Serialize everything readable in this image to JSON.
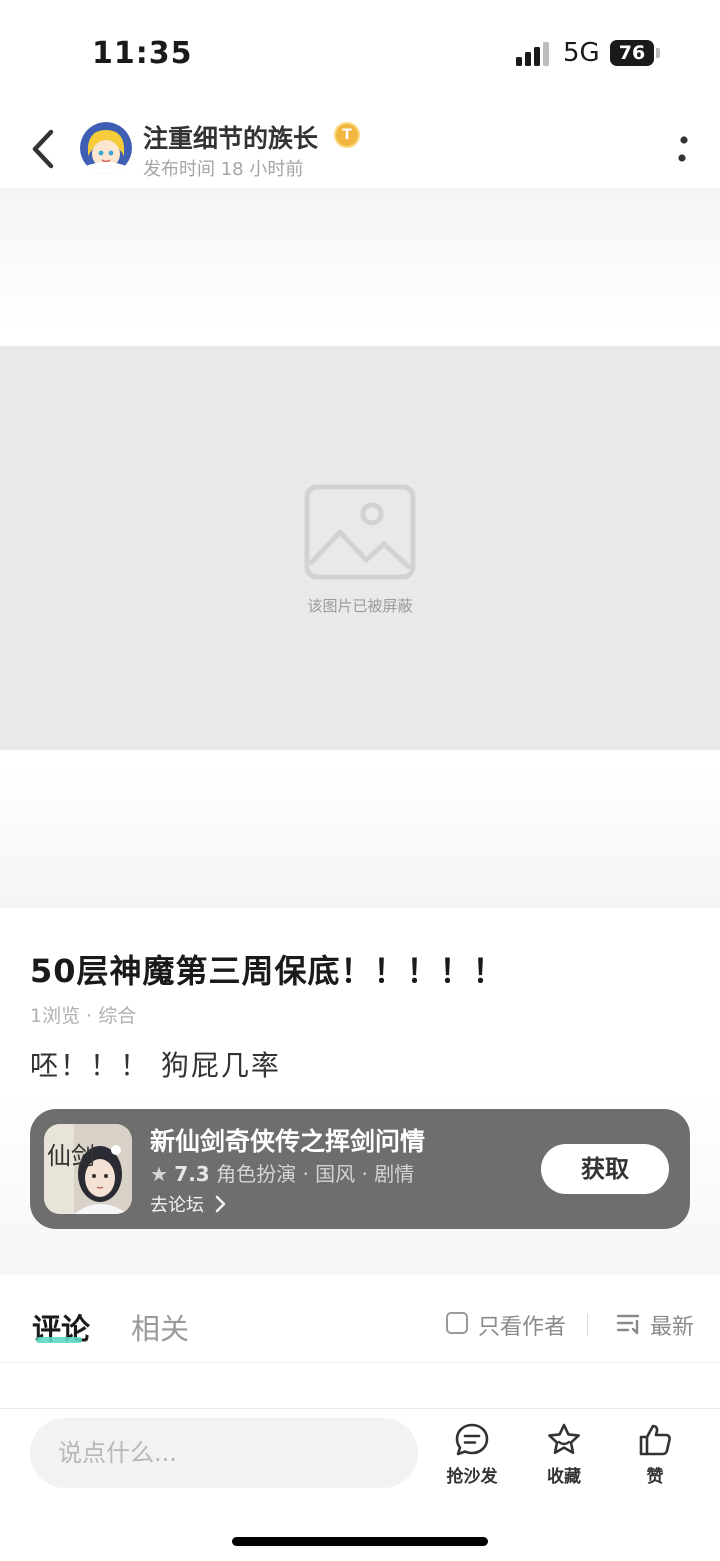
{
  "status_bar": {
    "time": "11:35",
    "network": "5G",
    "battery": "76"
  },
  "header": {
    "author_name": "注重细节的族长",
    "badge_letter": "T",
    "publish_time": "发布时间 18 小时前"
  },
  "media": {
    "blocked_text": "该图片已被屏蔽"
  },
  "post": {
    "title": "50层神魔第三周保底！！！！！",
    "meta": "1浏览 · 综合",
    "content": "呸！！！ 狗屁几率"
  },
  "game_card": {
    "name": "新仙剑奇侠传之挥剑问情",
    "rating": "7.3",
    "tags": "角色扮演 · 国风 · 剧情",
    "forum_link": "去论坛",
    "get_button": "获取",
    "icon_text": "仙剑"
  },
  "comments": {
    "tabs": [
      {
        "label": "评论",
        "active": true
      },
      {
        "label": "相关",
        "active": false
      }
    ],
    "only_author": "只看作者",
    "sort": "最新"
  },
  "bottom_bar": {
    "input_placeholder": "说点什么...",
    "actions": [
      {
        "label": "抢沙发",
        "icon": "comment-bubble-icon"
      },
      {
        "label": "收藏",
        "icon": "star-icon"
      },
      {
        "label": "赞",
        "icon": "thumbs-up-icon"
      }
    ]
  },
  "colors": {
    "accent": "#5ed8c2",
    "card_bg": "#6f6e6e",
    "badge": "#f2b640"
  }
}
